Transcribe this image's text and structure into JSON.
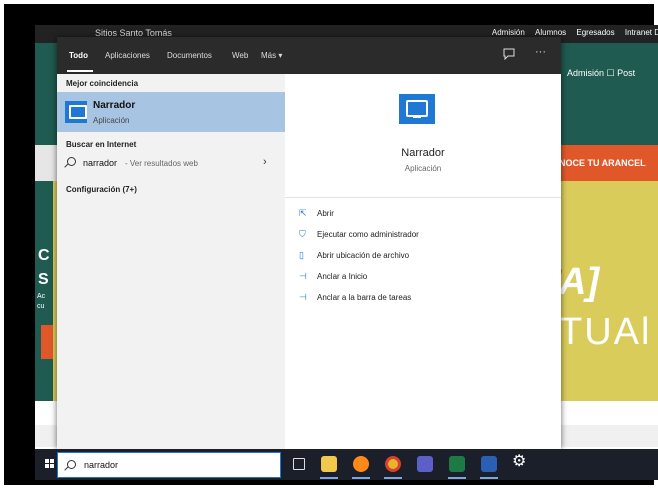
{
  "background_site": {
    "top_left_text": "Sitios Santo Tomás",
    "top_links": [
      "Admisión",
      "Alumnos",
      "Egresados",
      "Intranet D"
    ],
    "header_link": "Admisión ☐  Post",
    "arancel_button": "NOCE TU ARANCEL",
    "hero_fragment_1": "A]",
    "hero_fragment_2": "TUAl",
    "left_letters": [
      "C",
      "S"
    ],
    "left_small": [
      "Ac",
      "cu"
    ]
  },
  "start_menu": {
    "tabs": [
      "Todo",
      "Aplicaciones",
      "Documentos",
      "Web",
      "Más ▾"
    ],
    "feedback_icon": "feedback-icon",
    "more_icon": "ellipsis-icon",
    "best_match_title": "Mejor coincidencia",
    "best_match": {
      "name": "Narrador",
      "type": "Aplicación"
    },
    "internet_title": "Buscar en Internet",
    "web_search": {
      "term": "narrador",
      "hint": "- Ver resultados web"
    },
    "settings_title": "Configuración (7+)",
    "detail": {
      "name": "Narrador",
      "type": "Aplicación",
      "actions": [
        {
          "icon": "open-icon",
          "label": "Abrir"
        },
        {
          "icon": "shield-run-icon",
          "label": "Ejecutar como administrador"
        },
        {
          "icon": "folder-location-icon",
          "label": "Abrir ubicación de archivo"
        },
        {
          "icon": "pin-start-icon",
          "label": "Anclar a Inicio"
        },
        {
          "icon": "pin-taskbar-icon",
          "label": "Anclar a la barra de tareas"
        }
      ]
    }
  },
  "taskbar": {
    "search_value": "narrador",
    "apps": [
      "task-view-icon",
      "file-explorer-icon",
      "firefox-icon",
      "chrome-icon",
      "teams-icon",
      "excel-icon",
      "word-icon",
      "settings-gear-icon"
    ]
  },
  "colors": {
    "accent": "#1e78d4",
    "selected": "#a7c5e3",
    "site_green": "#1f5b50",
    "site_orange": "#e0582a"
  }
}
